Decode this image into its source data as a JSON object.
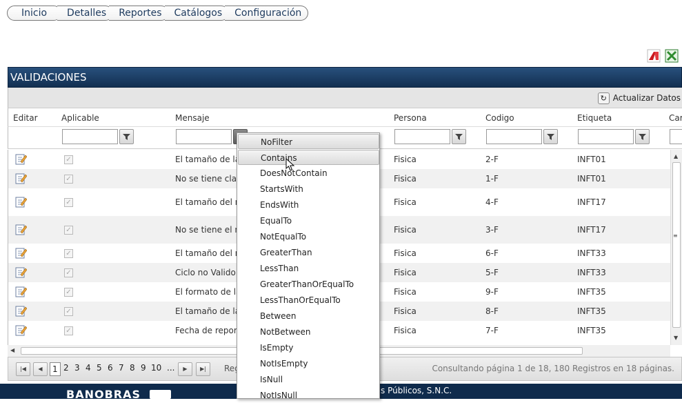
{
  "nav": {
    "tabs": [
      "Inicio",
      "Detalles",
      "Reportes",
      "Catálogos",
      "Configuración"
    ]
  },
  "grid": {
    "title": "VALIDACIONES",
    "refresh_label": "Actualizar Datos",
    "columns": [
      "Editar",
      "Aplicable",
      "Mensaje",
      "Persona",
      "Codigo",
      "Etiqueta",
      "Car"
    ],
    "rows": [
      {
        "mensaje": "El tamaño de la c",
        "persona": "Fisica",
        "codigo": "2-F",
        "etiqueta": "INFT01",
        "aplicable": true
      },
      {
        "mensaje": "No se tiene clave",
        "persona": "Fisica",
        "codigo": "1-F",
        "etiqueta": "INFT01",
        "aplicable": true
      },
      {
        "mensaje": "El tamaño del no",
        "persona": "Fisica",
        "codigo": "4-F",
        "etiqueta": "INFT17",
        "aplicable": true
      },
      {
        "mensaje": "No se tiene el no",
        "persona": "Fisica",
        "codigo": "3-F",
        "etiqueta": "INFT17",
        "aplicable": true
      },
      {
        "mensaje": "El tamaño del nu",
        "persona": "Fisica",
        "codigo": "6-F",
        "etiqueta": "INFT33",
        "aplicable": true
      },
      {
        "mensaje": "Ciclo no Valido",
        "persona": "Fisica",
        "codigo": "5-F",
        "etiqueta": "INFT33",
        "aplicable": true
      },
      {
        "mensaje": "El formato de la f",
        "persona": "Fisica",
        "codigo": "9-F",
        "etiqueta": "INFT35",
        "aplicable": true
      },
      {
        "mensaje": "El tamaño de la f",
        "persona": "Fisica",
        "codigo": "8-F",
        "etiqueta": "INFT35",
        "aplicable": true
      },
      {
        "mensaje": "Fecha de reporte",
        "persona": "Fisica",
        "codigo": "7-F",
        "etiqueta": "INFT35",
        "aplicable": true
      }
    ]
  },
  "pager": {
    "pages": [
      "1",
      "2",
      "3",
      "4",
      "5",
      "6",
      "7",
      "8",
      "9",
      "10",
      "..."
    ],
    "current": "1",
    "label": "Reg",
    "info": "Consultando página 1 de 18, 180 Registros en 18 páginas."
  },
  "filter_menu": {
    "items": [
      "NoFilter",
      "Contains",
      "DoesNotContain",
      "StartsWith",
      "EndsWith",
      "EqualTo",
      "NotEqualTo",
      "GreaterThan",
      "LessThan",
      "GreaterThanOrEqualTo",
      "LessThanOrEqualTo",
      "Between",
      "NotBetween",
      "IsEmpty",
      "NotIsEmpty",
      "IsNull",
      "NotIsNull"
    ],
    "highlighted": [
      "NoFilter",
      "Contains"
    ]
  },
  "footer": {
    "brand": "BANOBRAS",
    "note": "s Públicos, S.N.C."
  },
  "colors": {
    "header_bg": "#1b3d64",
    "footer_bg": "#0f2b4c",
    "accent": "#28507c"
  },
  "icons": {
    "export_pdf": "pdf-icon",
    "export_xls": "excel-icon",
    "refresh": "refresh-icon",
    "filter": "filter-funnel-icon",
    "edit": "edit-pencil-icon"
  }
}
